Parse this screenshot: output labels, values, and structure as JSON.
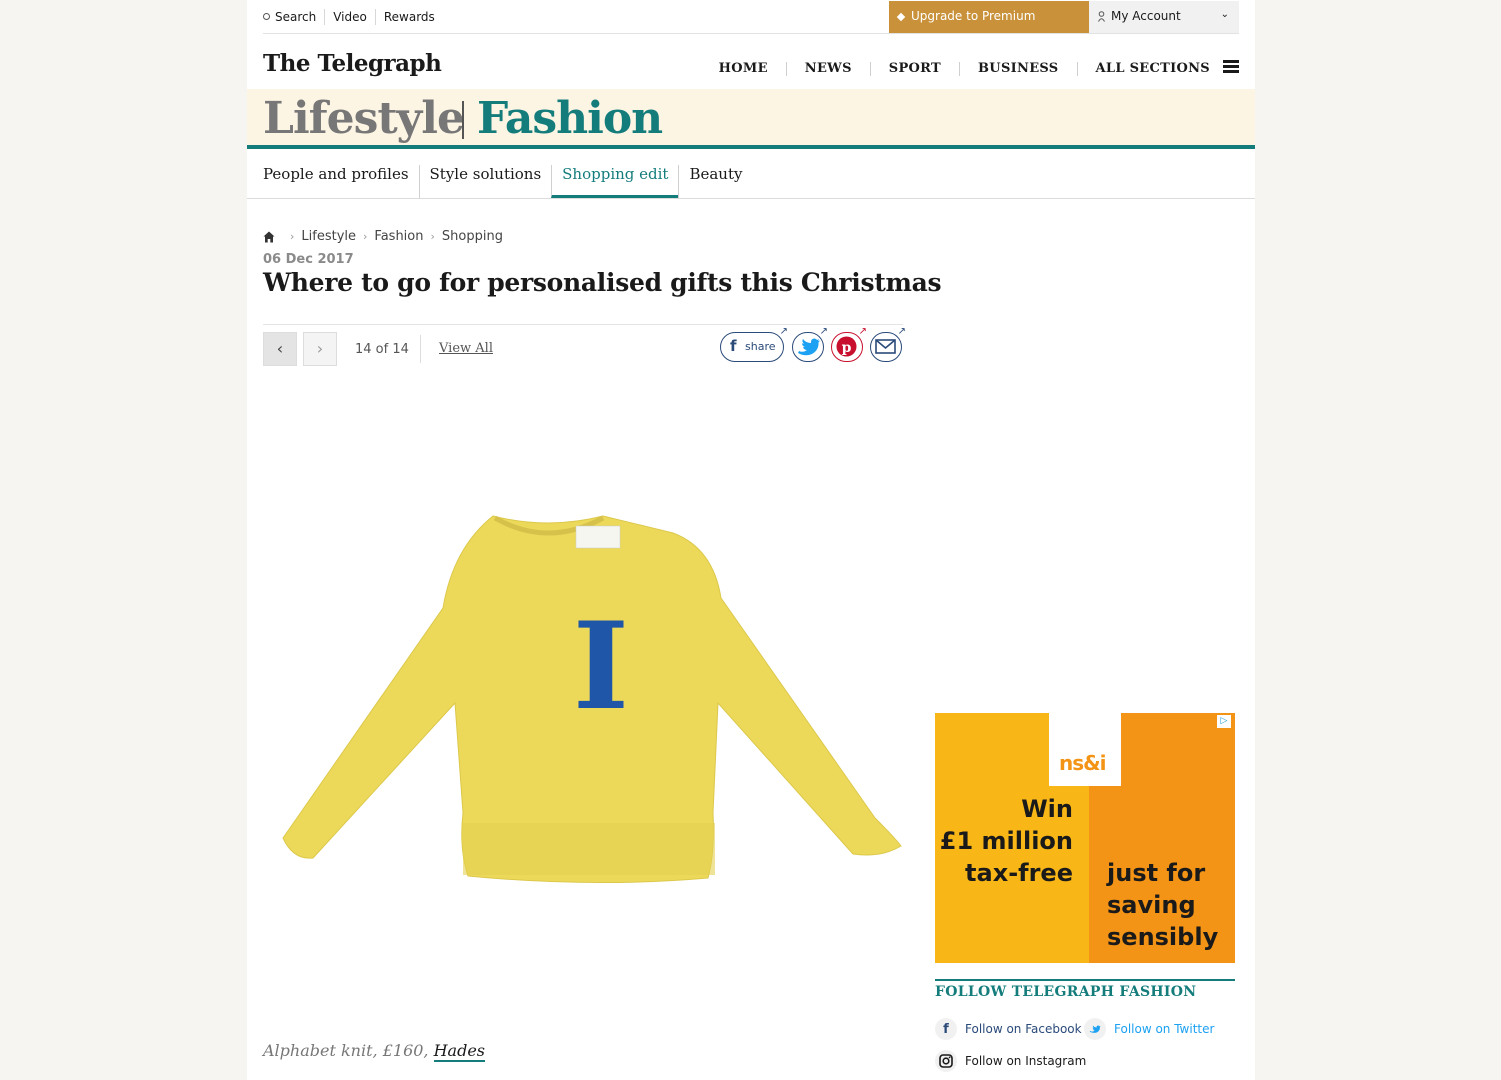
{
  "utility": {
    "links": [
      "Search",
      "Video",
      "Rewards"
    ],
    "premium_label": "Upgrade to Premium",
    "account_label": "My Account"
  },
  "masthead": {
    "logo": "The Telegraph",
    "nav": [
      "HOME",
      "NEWS",
      "SPORT",
      "BUSINESS",
      "ALL SECTIONS"
    ]
  },
  "section": {
    "primary": "Lifestyle",
    "secondary": "Fashion",
    "subnav": [
      "People and profiles",
      "Style solutions",
      "Shopping edit",
      "Beauty"
    ],
    "active_subnav": "Shopping edit"
  },
  "article": {
    "breadcrumb": [
      "Lifestyle",
      "Fashion",
      "Shopping"
    ],
    "date": "06 Dec 2017",
    "title": "Where to go for personalised gifts this Christmas"
  },
  "gallery": {
    "counter": "14 of 14",
    "view_all": "View All",
    "share_label": "share",
    "caption_text": "Alphabet knit, £160, ",
    "caption_link": "Hades",
    "sweater_letter": "I"
  },
  "ad": {
    "brand": "ns&i",
    "headline_lines": [
      "Win",
      "£1 million",
      "tax-free"
    ],
    "tagline_lines": [
      "just for",
      "saving",
      "sensibly"
    ]
  },
  "follow": {
    "title": "FOLLOW TELEGRAPH FASHION",
    "facebook": "Follow on Facebook",
    "twitter": "Follow on Twitter",
    "instagram": "Follow on Instagram"
  },
  "colors": {
    "accent": "#147d7c",
    "premium": "#c9923a",
    "sweater": "#ecd95a",
    "letter": "#1f56a8"
  }
}
